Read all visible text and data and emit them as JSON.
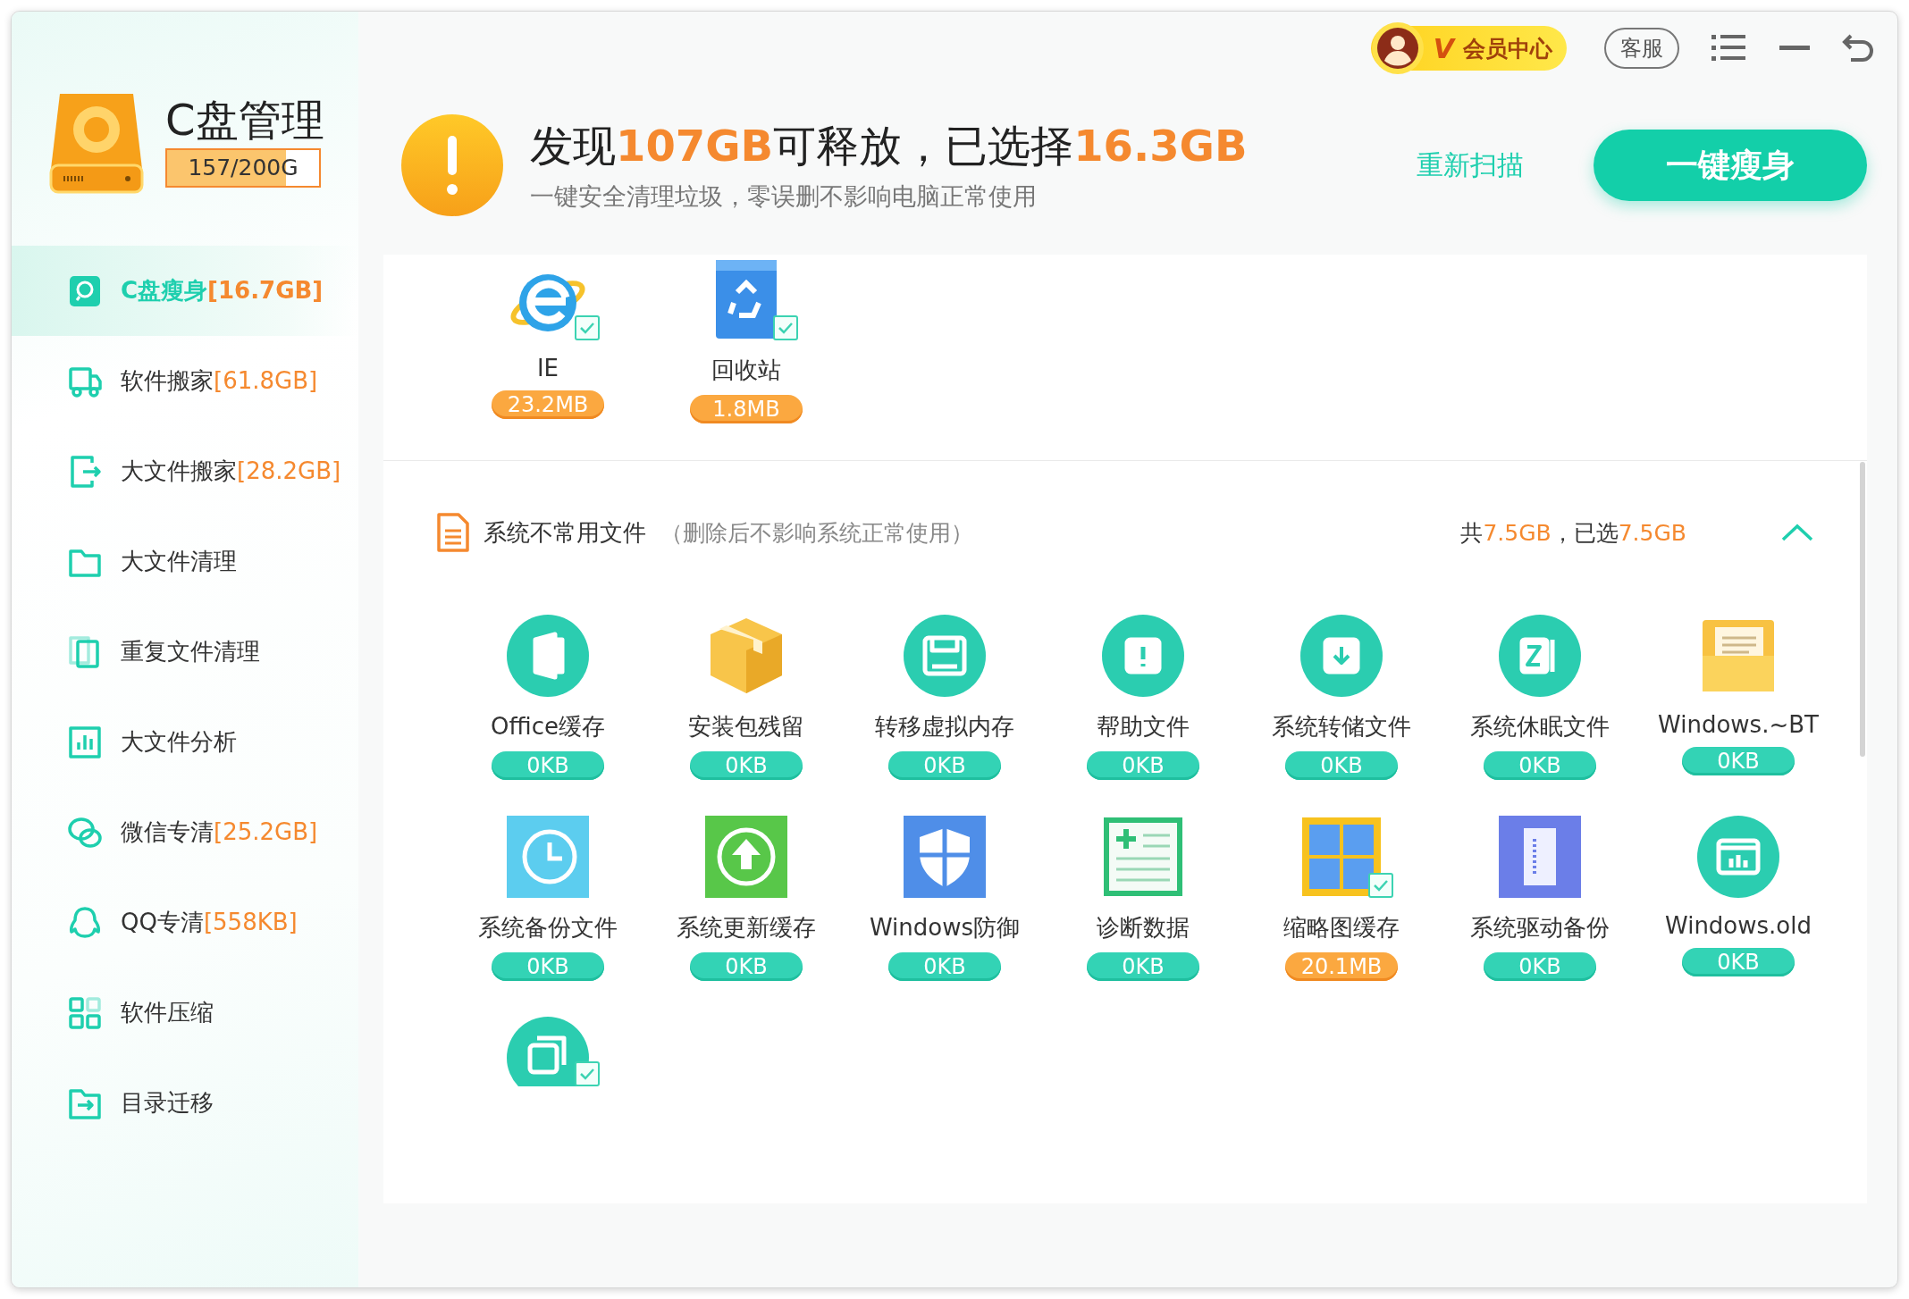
{
  "app": {
    "title": "C盘管理",
    "capacity": "157/200G",
    "level": 0.785
  },
  "top_controls": {
    "vip_mark": "V",
    "vip_label": "会员中心",
    "service": "客服"
  },
  "sidebar": {
    "items": [
      {
        "label": "C盘瘦身",
        "size": "[16.7GB]",
        "selected": true
      },
      {
        "label": "软件搬家",
        "size": "[61.8GB]",
        "selected": false
      },
      {
        "label": "大文件搬家",
        "size": "[28.2GB]",
        "selected": false
      },
      {
        "label": "大文件清理",
        "selected": false
      },
      {
        "label": "重复文件清理",
        "selected": false
      },
      {
        "label": "大文件分析",
        "selected": false
      },
      {
        "label": "微信专清",
        "size": "[25.2GB]",
        "selected": false
      },
      {
        "label": "QQ专清",
        "size": "[558KB]",
        "selected": false
      },
      {
        "label": "软件压缩",
        "selected": false
      },
      {
        "label": "目录迁移",
        "selected": false
      }
    ]
  },
  "header": {
    "headline": "发现**107GB**可释放，已选择**16.3GB**",
    "subtitle": "一键安全清理垃圾，零误删不影响电脑正常使用",
    "rescan": "重新扫描",
    "primary_button": "一键瘦身"
  },
  "top_items": [
    {
      "label": "IE",
      "size": "23.2MB",
      "checked": true
    },
    {
      "label": "回收站",
      "size": "1.8MB",
      "checked": true
    }
  ],
  "section": {
    "title": "系统不常用文件",
    "note": "（删除后不影响系统正常使用）",
    "summary": "共**7.5GB**，已选**7.5GB**",
    "expanded": true,
    "items": [
      {
        "label": "Office缓存",
        "size": "0KB",
        "checked": false
      },
      {
        "label": "安装包残留",
        "size": "0KB",
        "checked": false
      },
      {
        "label": "转移虚拟内存",
        "size": "0KB",
        "checked": false
      },
      {
        "label": "帮助文件",
        "size": "0KB",
        "checked": false
      },
      {
        "label": "系统转储文件",
        "size": "0KB",
        "checked": false
      },
      {
        "label": "系统休眠文件",
        "size": "0KB",
        "checked": false
      },
      {
        "label": "Windows.~BT",
        "size": "0KB",
        "checked": false
      },
      {
        "label": "系统备份文件",
        "size": "0KB",
        "checked": false
      },
      {
        "label": "系统更新缓存",
        "size": "0KB",
        "checked": false
      },
      {
        "label": "Windows防御",
        "size": "0KB",
        "checked": false
      },
      {
        "label": "诊断数据",
        "size": "0KB",
        "checked": false
      },
      {
        "label": "缩略图缓存",
        "size": "20.1MB",
        "checked": true
      },
      {
        "label": "系统驱动备份",
        "size": "0KB",
        "checked": false
      },
      {
        "label": "Windows.old",
        "size": "0KB",
        "checked": false
      },
      {
        "checked": true
      }
    ]
  }
}
